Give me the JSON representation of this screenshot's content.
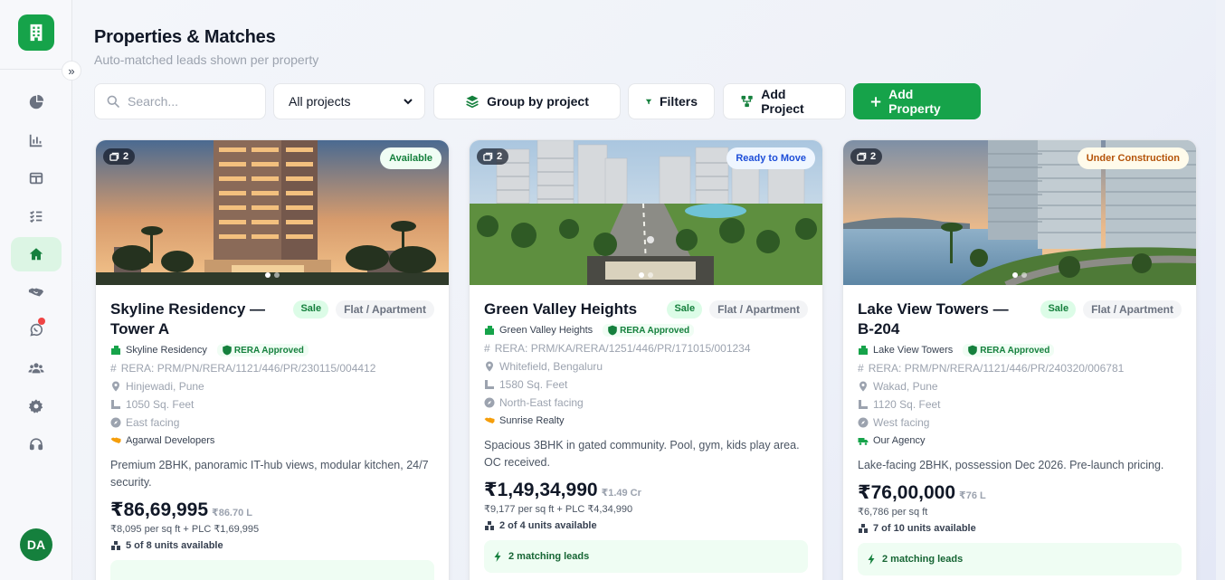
{
  "sidebar": {
    "avatar_initials": "DA",
    "items": [
      {
        "icon": "pie-chart-icon"
      },
      {
        "icon": "bar-chart-icon"
      },
      {
        "icon": "layout-icon"
      },
      {
        "icon": "checklist-icon"
      },
      {
        "icon": "home-icon",
        "active": true
      },
      {
        "icon": "handshake-icon"
      },
      {
        "icon": "whatsapp-icon",
        "notification": true
      },
      {
        "icon": "users-icon"
      },
      {
        "icon": "settings-icon"
      },
      {
        "icon": "headset-icon"
      }
    ]
  },
  "header": {
    "title": "Properties & Matches",
    "subtitle": "Auto-matched leads shown per property"
  },
  "toolbar": {
    "search_placeholder": "Search...",
    "project_filter": "All projects",
    "group_label": "Group by project",
    "filters_label": "Filters",
    "add_project_label": "Add Project",
    "add_property_label": "Add Property"
  },
  "colors": {
    "brand": "#16a34a",
    "brand_dark": "#15803d"
  },
  "cards": [
    {
      "title": "Skyline Residency — Tower A",
      "photos": "2",
      "status": "Available",
      "status_color": "#15803d",
      "listing_type": "Sale",
      "property_type": "Flat / Apartment",
      "project": "Skyline Residency",
      "rera_badge": "RERA Approved",
      "rera_number": "RERA: PRM/PN/RERA/1121/446/PR/230115/004412",
      "location": "Hinjewadi, Pune",
      "area": "1050 Sq. Feet",
      "facing": "East facing",
      "agent": "Agarwal Developers",
      "description": "Premium 2BHK, panoramic IT-hub views, modular kitchen, 24/7 security.",
      "price": "₹86,69,995",
      "price_short": "₹86.70 L",
      "price_detail": "₹8,095 per sq ft + PLC ₹1,69,995",
      "units": "5 of 8 units available",
      "leads": ""
    },
    {
      "title": "Green Valley Heights",
      "photos": "2",
      "status": "Ready to Move",
      "status_color": "#1d4ed8",
      "listing_type": "Sale",
      "property_type": "Flat / Apartment",
      "project": "Green Valley Heights",
      "rera_badge": "RERA Approved",
      "rera_number": "RERA: PRM/KA/RERA/1251/446/PR/171015/001234",
      "location": "Whitefield, Bengaluru",
      "area": "1580 Sq. Feet",
      "facing": "North-East facing",
      "agent": "Sunrise Realty",
      "description": "Spacious 3BHK in gated community. Pool, gym, kids play area. OC received.",
      "price": "₹1,49,34,990",
      "price_short": "₹1.49 Cr",
      "price_detail": "₹9,177 per sq ft + PLC ₹4,34,990",
      "units": "2 of 4 units available",
      "leads": "2 matching leads"
    },
    {
      "title": "Lake View Towers — B-204",
      "photos": "2",
      "status": "Under Construction",
      "status_color": "#b45309",
      "listing_type": "Sale",
      "property_type": "Flat / Apartment",
      "project": "Lake View Towers",
      "rera_badge": "RERA Approved",
      "rera_number": "RERA: PRM/PN/RERA/1121/446/PR/240320/006781",
      "location": "Wakad, Pune",
      "area": "1120 Sq. Feet",
      "facing": "West facing",
      "agent": "Our Agency",
      "description": "Lake-facing 2BHK, possession Dec 2026. Pre-launch pricing.",
      "price": "₹76,00,000",
      "price_short": "₹76 L",
      "price_detail": "₹6,786 per sq ft",
      "units": "7 of 10 units available",
      "leads": "2 matching leads"
    }
  ]
}
